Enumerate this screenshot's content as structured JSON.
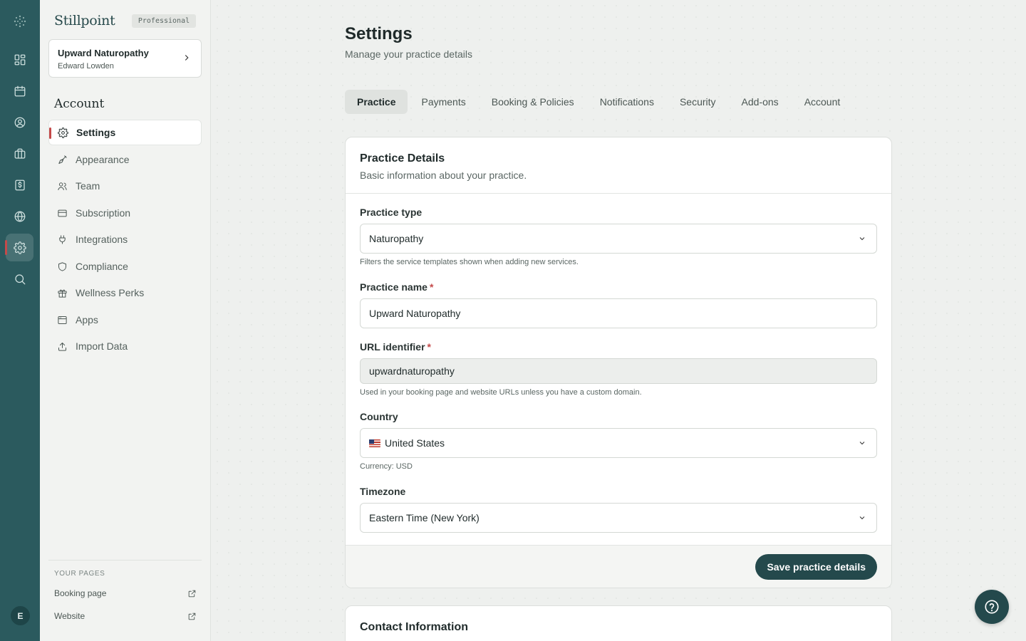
{
  "brand": {
    "name": "Stillpoint",
    "plan": "Professional"
  },
  "practice_switcher": {
    "name": "Upward Naturopathy",
    "owner": "Edward Lowden"
  },
  "rail": {
    "items": [
      {
        "icon": "dashboard-icon"
      },
      {
        "icon": "calendar-icon"
      },
      {
        "icon": "clients-icon"
      },
      {
        "icon": "briefcase-icon"
      },
      {
        "icon": "billing-icon"
      },
      {
        "icon": "globe-icon"
      },
      {
        "icon": "gear-icon",
        "active": true
      },
      {
        "icon": "search-icon"
      }
    ],
    "avatar_initial": "E"
  },
  "sidebar": {
    "section_title": "Account",
    "items": [
      {
        "label": "Settings",
        "icon": "gear-icon",
        "active": true
      },
      {
        "label": "Appearance",
        "icon": "brush-icon"
      },
      {
        "label": "Team",
        "icon": "team-icon"
      },
      {
        "label": "Subscription",
        "icon": "card-icon"
      },
      {
        "label": "Integrations",
        "icon": "plug-icon"
      },
      {
        "label": "Compliance",
        "icon": "shield-icon"
      },
      {
        "label": "Wellness Perks",
        "icon": "gift-icon"
      },
      {
        "label": "Apps",
        "icon": "window-icon"
      },
      {
        "label": "Import Data",
        "icon": "upload-icon"
      }
    ],
    "your_pages_label": "YOUR PAGES",
    "pages": [
      {
        "label": "Booking page",
        "icon": "external-link-icon"
      },
      {
        "label": "Website",
        "icon": "external-link-icon"
      }
    ]
  },
  "header": {
    "title": "Settings",
    "subtitle": "Manage your practice details"
  },
  "tabs": [
    {
      "label": "Practice",
      "active": true
    },
    {
      "label": "Payments"
    },
    {
      "label": "Booking & Policies"
    },
    {
      "label": "Notifications"
    },
    {
      "label": "Security"
    },
    {
      "label": "Add-ons"
    },
    {
      "label": "Account"
    }
  ],
  "practice_details": {
    "title": "Practice Details",
    "description": "Basic information about your practice.",
    "practice_type": {
      "label": "Practice type",
      "value": "Naturopathy",
      "help": "Filters the service templates shown when adding new services."
    },
    "practice_name": {
      "label": "Practice name",
      "required": "*",
      "value": "Upward Naturopathy"
    },
    "url_identifier": {
      "label": "URL identifier",
      "required": "*",
      "value": "upwardnaturopathy",
      "help": "Used in your booking page and website URLs unless you have a custom domain."
    },
    "country": {
      "label": "Country",
      "value": "United States",
      "help": "Currency: USD"
    },
    "timezone": {
      "label": "Timezone",
      "value": "Eastern Time (New York)"
    },
    "save_label": "Save practice details"
  },
  "contact_info": {
    "title": "Contact Information"
  },
  "colors": {
    "rail": "#2b5a5e",
    "accent": "#24494c",
    "active_marker": "#c44a4a"
  }
}
